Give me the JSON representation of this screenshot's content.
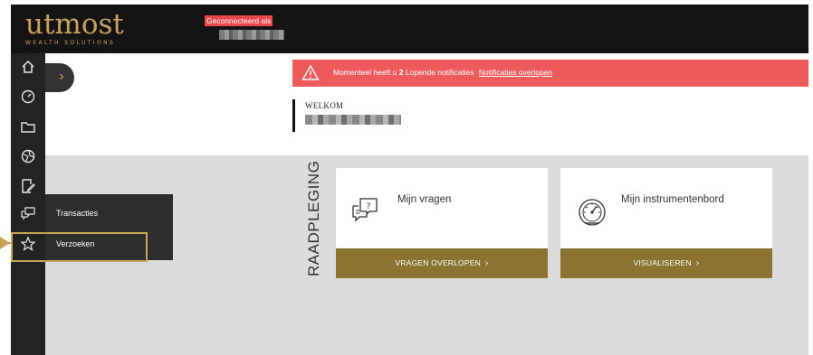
{
  "header": {
    "logo_text": "utmost",
    "logo_tagline": "WEALTH SOLUTIONS",
    "connected_label": "Geconnecteerd als"
  },
  "rail": {
    "icons": [
      "home-icon",
      "gauge-icon",
      "folder-icon",
      "globe-icon",
      "edit-document-icon",
      "chat-icon",
      "star-icon"
    ]
  },
  "sidebar": {
    "expand_glyph": "›",
    "flyout_items": [
      {
        "label": "Transacties"
      },
      {
        "label": "Verzoeken"
      }
    ]
  },
  "alert": {
    "text": "Momenteel heeft u",
    "count": "2",
    "suffix": "Lopende notificaties",
    "link_text": "Notificaties overlopen"
  },
  "welcome": {
    "label": "WELKOM"
  },
  "section": {
    "side_label": "RAADPLEGING"
  },
  "cards": [
    {
      "title": "Mijn vragen",
      "button": "VRAGEN OVERLOPEN",
      "icon": "question-chat-icon"
    },
    {
      "title": "Mijn instrumentenbord",
      "button": "VISUALISEREN",
      "icon": "dashboard-gauge-icon"
    }
  ],
  "colors": {
    "header_bg": "#141414",
    "brand_gold": "#c7a25e",
    "alert_red": "#ee5b5c",
    "button_olive": "#8b7431",
    "highlight": "#c5a553"
  }
}
